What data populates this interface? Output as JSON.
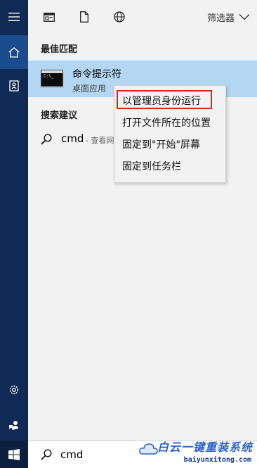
{
  "rail": {
    "icons": [
      "hamburger-menu-icon",
      "home-icon",
      "notebook-icon",
      "settings-icon",
      "feedback-icon",
      "windows-logo-icon"
    ],
    "active_color": "#1a4b8c",
    "background": "#0f2a55"
  },
  "topbar": {
    "icons": [
      "apps-icon",
      "documents-icon",
      "web-icon"
    ],
    "filter_label": "筛选器"
  },
  "best_match": {
    "heading": "最佳匹配",
    "app_name": "命令提示符",
    "app_type": "桌面应用",
    "icon_prompt": "C:\\_",
    "highlight_color": "#b3d7f2"
  },
  "suggestions": {
    "heading": "搜索建议",
    "items": [
      {
        "term": "cmd",
        "hint": "- 查看网"
      }
    ]
  },
  "context_menu": {
    "items": [
      "以管理员身份运行",
      "打开文件所在的位置",
      "固定到\"开始\"屏幕",
      "固定到任务栏"
    ],
    "highlighted_index": 0,
    "highlight_color": "#e31f1f"
  },
  "search": {
    "value": "cmd",
    "placeholder": ""
  },
  "watermark": {
    "title": "白云一键重装系统",
    "url": "baiyunxitong.com"
  }
}
